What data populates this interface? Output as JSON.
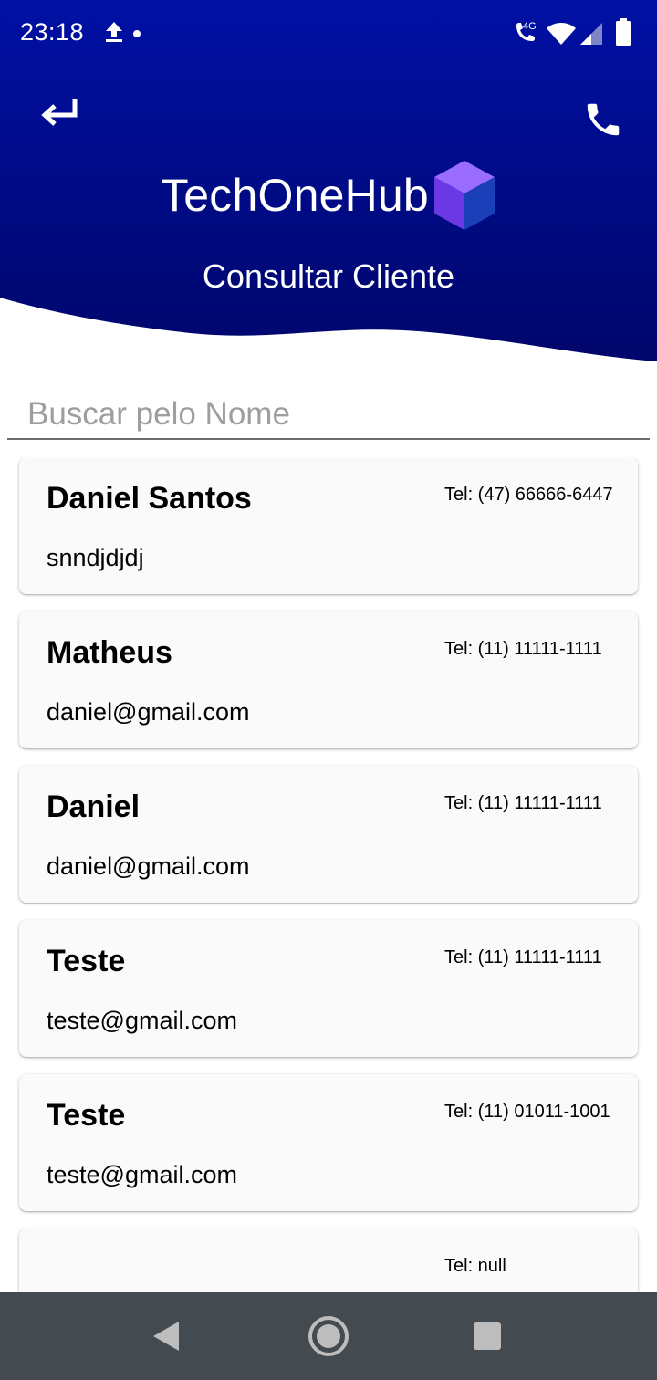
{
  "status_bar": {
    "time": "23:18",
    "network_label": "4G",
    "icons": [
      "upload-icon",
      "notification-dot",
      "wifi-call-icon",
      "wifi-icon",
      "signal-icon",
      "battery-icon"
    ]
  },
  "header": {
    "background_color": "#000a9e",
    "back_icon": "back-arrow-icon",
    "call_icon": "phone-icon",
    "brand_title": "TechOneHub",
    "logo_icon": "cube-logo-icon",
    "page_title": "Consultar Cliente"
  },
  "search": {
    "placeholder": "Buscar pelo Nome",
    "value": ""
  },
  "clients": [
    {
      "name": "Daniel Santos",
      "email": "snndjdjdj",
      "phone": "Tel: (47) 66666-6447"
    },
    {
      "name": "Matheus",
      "email": "daniel@gmail.com",
      "phone": "Tel: (11) 11111-1111"
    },
    {
      "name": "Daniel",
      "email": "daniel@gmail.com",
      "phone": "Tel: (11) 11111-1111"
    },
    {
      "name": "Teste",
      "email": "teste@gmail.com",
      "phone": "Tel: (11) 11111-1111"
    },
    {
      "name": "Teste",
      "email": "teste@gmail.com",
      "phone": "Tel: (11) 01011-1001"
    },
    {
      "name": "",
      "email": "",
      "phone": "Tel: null"
    }
  ],
  "nav_bar": {
    "background_color": "#434a50",
    "icons": [
      "nav-back-icon",
      "nav-home-icon",
      "nav-recents-icon"
    ]
  }
}
